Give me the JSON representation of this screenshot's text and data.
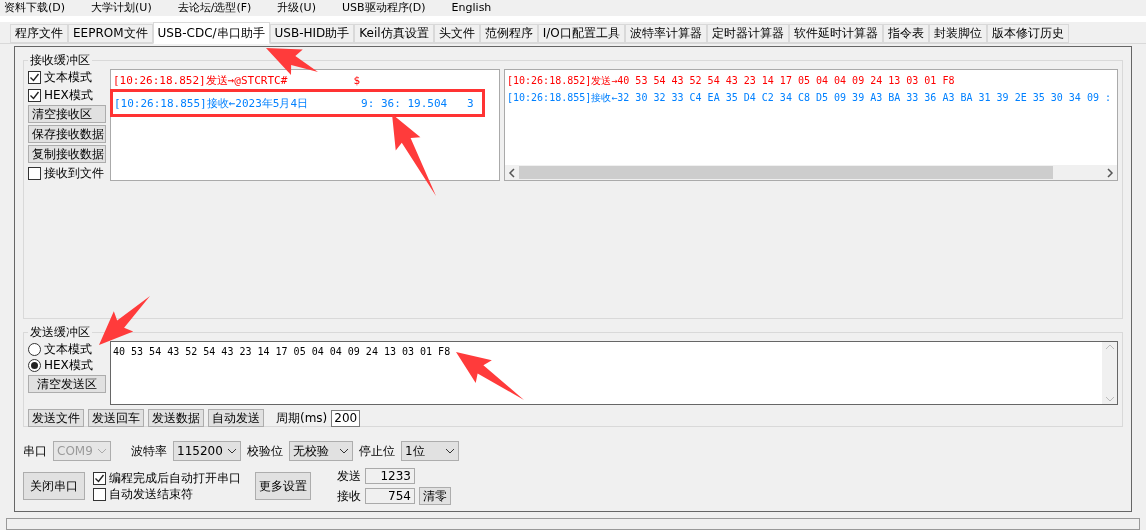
{
  "menu": [
    "资料下载(D)",
    "大学计划(U)",
    "去论坛/选型(F)",
    "升级(U)",
    "USB驱动程序(D)",
    "English"
  ],
  "tabs": [
    {
      "label": "程序文件",
      "selected": false
    },
    {
      "label": "EEPROM文件",
      "selected": false
    },
    {
      "label": "USB-CDC/串口助手",
      "selected": true
    },
    {
      "label": "USB-HID助手",
      "selected": false
    },
    {
      "label": "Keil仿真设置",
      "selected": false
    },
    {
      "label": "头文件",
      "selected": false
    },
    {
      "label": "范例程序",
      "selected": false
    },
    {
      "label": "I/O口配置工具",
      "selected": false
    },
    {
      "label": "波特率计算器",
      "selected": false
    },
    {
      "label": "定时器计算器",
      "selected": false
    },
    {
      "label": "软件延时计算器",
      "selected": false
    },
    {
      "label": "指令表",
      "selected": false
    },
    {
      "label": "封装脚位",
      "selected": false
    },
    {
      "label": "版本修订历史",
      "selected": false
    }
  ],
  "receive": {
    "title": "接收缓冲区",
    "options": [
      {
        "kind": "checkbox",
        "label": "文本模式",
        "checked": true
      },
      {
        "kind": "checkbox",
        "label": "HEX模式",
        "checked": true
      },
      {
        "kind": "button",
        "label": "清空接收区"
      },
      {
        "kind": "button",
        "label": "保存接收数据"
      },
      {
        "kind": "button",
        "label": "复制接收数据"
      },
      {
        "kind": "checkbox",
        "label": "接收到文件",
        "checked": false
      }
    ],
    "text_lines": [
      {
        "text": "[10:26:18.852]发送→@STCRTC#          $",
        "color": "#ff0000"
      },
      {
        "text": "[10:26:18.855]接收←2023年5月4日        9: 36: 19.504   3",
        "color": "#0080ff"
      }
    ],
    "hex_lines": [
      {
        "text": "[10:26:18.852]发送→40 53 54 43 52 54 43 23 14 17 05 04 04 09 24 13 03 01 F8",
        "color": "#ff0000"
      },
      {
        "text": "[10:26:18.855]接收←32 30 32 33 C4 EA 35 D4 C2 34 C8 D5 09 39 A3 BA 33 36 A3 BA 31 39 2E 35 30 34 09 :",
        "color": "#0080ff"
      }
    ]
  },
  "send": {
    "title": "发送缓冲区",
    "modes": [
      {
        "label": "文本模式",
        "selected": false
      },
      {
        "label": "HEX模式",
        "selected": true
      }
    ],
    "clear_button": "清空发送区",
    "value": "40 53 54 43 52 54 43 23 14 17 05 04 04 09 24 13 03 01 F8",
    "buttons": [
      "发送文件",
      "发送回车",
      "发送数据",
      "自动发送"
    ],
    "period_label": "周期(ms)",
    "period_value": "200"
  },
  "serial": {
    "port_label": "串口",
    "port_value": "COM9",
    "port_disabled": true,
    "baud_label": "波特率",
    "baud_value": "115200",
    "parity_label": "校验位",
    "parity_value": "无校验",
    "stop_label": "停止位",
    "stop_value": "1位"
  },
  "bottom": {
    "close_button": "关闭串口",
    "checkboxes": [
      {
        "label": "编程完成后自动打开串口",
        "checked": true
      },
      {
        "label": "自动发送结束符",
        "checked": false
      }
    ],
    "more_button": "更多设置",
    "sent_label": "发送",
    "sent_value": "1233",
    "received_label": "接收",
    "received_value": "754",
    "reset_button": "清零"
  }
}
